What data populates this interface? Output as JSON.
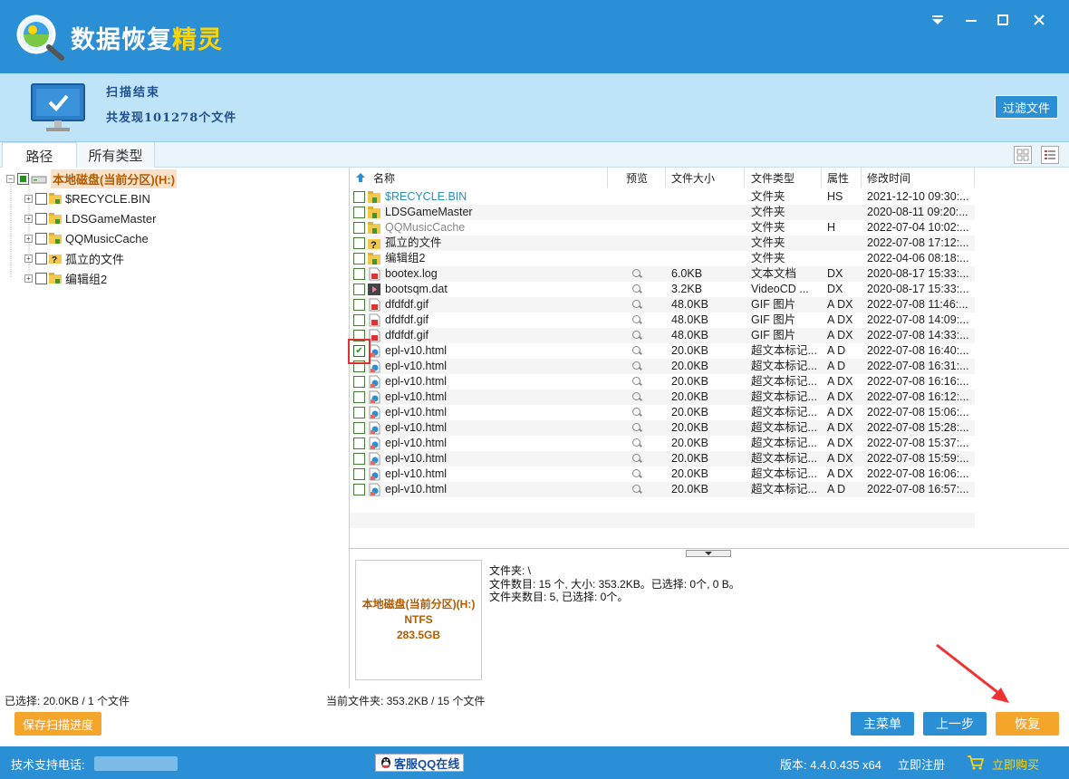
{
  "app": {
    "title_main": "数据恢复",
    "title_accent": "精灵",
    "accent_color": "#ffd400",
    "brand_color": "#2b8fd6"
  },
  "window_controls": [
    "menu-icon",
    "minimize-icon",
    "maximize-icon",
    "close-icon"
  ],
  "scan": {
    "status": "扫描结束",
    "summary": "共发现101278个文件",
    "filter_button": "过滤文件"
  },
  "tabs": [
    {
      "label": "路径",
      "active": true
    },
    {
      "label": "所有类型",
      "active": false
    }
  ],
  "tree": {
    "root": "本地磁盘(当前分区)(H:)",
    "items": [
      "$RECYCLE.BIN",
      "LDSGameMaster",
      "QQMusicCache",
      "孤立的文件",
      "编辑组2"
    ]
  },
  "columns": [
    "名称",
    "预览",
    "文件大小",
    "文件类型",
    "属性",
    "修改时间"
  ],
  "files": [
    {
      "name": "$RECYCLE.BIN",
      "size": "",
      "type": "文件夹",
      "attr": "HS",
      "mtime": "2021-12-10 09:30:...",
      "icon": "folder",
      "preview": false,
      "checked": false,
      "style": "recycle"
    },
    {
      "name": "LDSGameMaster",
      "size": "",
      "type": "文件夹",
      "attr": "",
      "mtime": "2020-08-11 09:20:...",
      "icon": "folder",
      "preview": false,
      "checked": false,
      "style": ""
    },
    {
      "name": "QQMusicCache",
      "size": "",
      "type": "文件夹",
      "attr": "H",
      "mtime": "2022-07-04 10:02:...",
      "icon": "folder",
      "preview": false,
      "checked": false,
      "style": "hidden"
    },
    {
      "name": "孤立的文件",
      "size": "",
      "type": "文件夹",
      "attr": "",
      "mtime": "2022-07-08 17:12:...",
      "icon": "question",
      "preview": false,
      "checked": false,
      "style": ""
    },
    {
      "name": "编辑组2",
      "size": "",
      "type": "文件夹",
      "attr": "",
      "mtime": "2022-04-06 08:18:...",
      "icon": "folder",
      "preview": false,
      "checked": false,
      "style": ""
    },
    {
      "name": "bootex.log",
      "size": "6.0KB",
      "type": "文本文档",
      "attr": "DX",
      "mtime": "2020-08-17 15:33:...",
      "icon": "doc",
      "preview": true,
      "checked": false,
      "style": ""
    },
    {
      "name": "bootsqm.dat",
      "size": "3.2KB",
      "type": "VideoCD ...",
      "attr": "DX",
      "mtime": "2020-08-17 15:33:...",
      "icon": "video",
      "preview": true,
      "checked": false,
      "style": ""
    },
    {
      "name": "dfdfdf.gif",
      "size": "48.0KB",
      "type": "GIF 图片",
      "attr": "A DX",
      "mtime": "2022-07-08 11:46:...",
      "icon": "doc",
      "preview": true,
      "checked": false,
      "style": ""
    },
    {
      "name": "dfdfdf.gif",
      "size": "48.0KB",
      "type": "GIF 图片",
      "attr": "A DX",
      "mtime": "2022-07-08 14:09:...",
      "icon": "doc",
      "preview": true,
      "checked": false,
      "style": ""
    },
    {
      "name": "dfdfdf.gif",
      "size": "48.0KB",
      "type": "GIF 图片",
      "attr": "A DX",
      "mtime": "2022-07-08 14:33:...",
      "icon": "doc",
      "preview": true,
      "checked": false,
      "style": ""
    },
    {
      "name": "epl-v10.html",
      "size": "20.0KB",
      "type": "超文本标记...",
      "attr": "A D",
      "mtime": "2022-07-08 16:40:...",
      "icon": "html",
      "preview": true,
      "checked": true,
      "style": ""
    },
    {
      "name": "epl-v10.html",
      "size": "20.0KB",
      "type": "超文本标记...",
      "attr": "A D",
      "mtime": "2022-07-08 16:31:...",
      "icon": "html",
      "preview": true,
      "checked": false,
      "style": ""
    },
    {
      "name": "epl-v10.html",
      "size": "20.0KB",
      "type": "超文本标记...",
      "attr": "A DX",
      "mtime": "2022-07-08 16:16:...",
      "icon": "html",
      "preview": true,
      "checked": false,
      "style": ""
    },
    {
      "name": "epl-v10.html",
      "size": "20.0KB",
      "type": "超文本标记...",
      "attr": "A DX",
      "mtime": "2022-07-08 16:12:...",
      "icon": "html",
      "preview": true,
      "checked": false,
      "style": ""
    },
    {
      "name": "epl-v10.html",
      "size": "20.0KB",
      "type": "超文本标记...",
      "attr": "A DX",
      "mtime": "2022-07-08 15:06:...",
      "icon": "html",
      "preview": true,
      "checked": false,
      "style": ""
    },
    {
      "name": "epl-v10.html",
      "size": "20.0KB",
      "type": "超文本标记...",
      "attr": "A DX",
      "mtime": "2022-07-08 15:28:...",
      "icon": "html",
      "preview": true,
      "checked": false,
      "style": ""
    },
    {
      "name": "epl-v10.html",
      "size": "20.0KB",
      "type": "超文本标记...",
      "attr": "A DX",
      "mtime": "2022-07-08 15:37:...",
      "icon": "html",
      "preview": true,
      "checked": false,
      "style": ""
    },
    {
      "name": "epl-v10.html",
      "size": "20.0KB",
      "type": "超文本标记...",
      "attr": "A DX",
      "mtime": "2022-07-08 15:59:...",
      "icon": "html",
      "preview": true,
      "checked": false,
      "style": ""
    },
    {
      "name": "epl-v10.html",
      "size": "20.0KB",
      "type": "超文本标记...",
      "attr": "A DX",
      "mtime": "2022-07-08 16:06:...",
      "icon": "html",
      "preview": true,
      "checked": false,
      "style": ""
    },
    {
      "name": "epl-v10.html",
      "size": "20.0KB",
      "type": "超文本标记...",
      "attr": "A D",
      "mtime": "2022-07-08 16:57:...",
      "icon": "html",
      "preview": true,
      "checked": false,
      "style": ""
    }
  ],
  "disk": {
    "name": "本地磁盘(当前分区)(H:)",
    "fs": "NTFS",
    "size": "283.5GB"
  },
  "info": {
    "line1": "文件夹: \\",
    "line2": "文件数目: 15 个, 大小: 353.2KB。已选择: 0个, 0 B。",
    "line3": "文件夹数目: 5, 已选择: 0个。"
  },
  "status": {
    "selected": "已选择: 20.0KB / 1 个文件",
    "current": "当前文件夹: 353.2KB / 15 个文件"
  },
  "buttons": {
    "save_scan": "保存扫描进度",
    "main_menu": "主菜单",
    "prev_step": "上一步",
    "recover": "恢复"
  },
  "footer": {
    "support": "技术支持电话:",
    "qq": "客服QQ在线",
    "version": "版本: 4.4.0.435 x64",
    "register": "立即注册",
    "buy": "立即购买"
  }
}
